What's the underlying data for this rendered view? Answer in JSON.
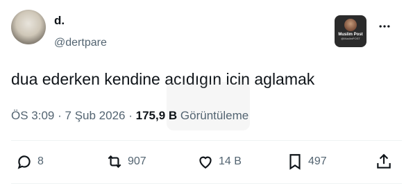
{
  "author": {
    "name": "d.",
    "handle": "@dertpare"
  },
  "badge": {
    "title": "Muslim Post",
    "subtitle": "@MuslimPOST"
  },
  "tweet": {
    "text": "dua ederken kendine acıdıgın icin aglamak",
    "time": "ÖS 3:09",
    "date": "7 Şub 2026",
    "separator": "·",
    "views_count": "175,9 B",
    "views_label": "Görüntüleme"
  },
  "actions": {
    "replies": "8",
    "reposts": "907",
    "likes": "14 B",
    "bookmarks": "497"
  },
  "icons": {
    "reply": "reply-icon",
    "repost": "repost-icon",
    "like": "heart-icon",
    "bookmark": "bookmark-icon",
    "share": "share-icon",
    "more": "more-icon"
  },
  "colors": {
    "text": "#0f1419",
    "secondary": "#536471"
  }
}
